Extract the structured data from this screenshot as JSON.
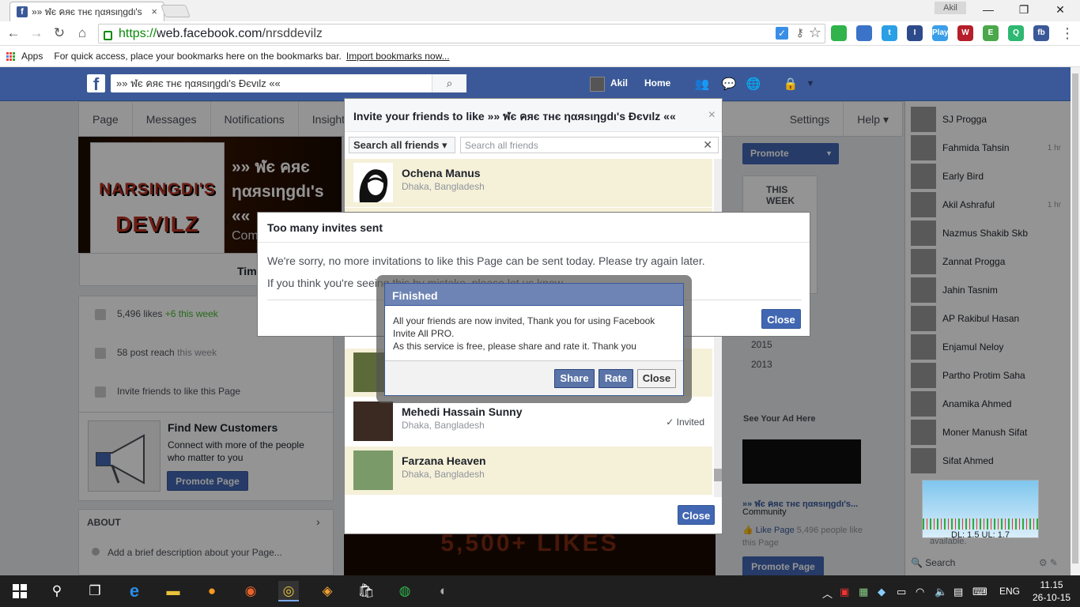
{
  "browser": {
    "tab_title": "»» ฬє คяє тнє ηαяsιηgdι's",
    "tab_close": "×",
    "user_badge": "Akil",
    "win_min": "—",
    "win_max": "❐",
    "win_close": "✕",
    "url_scheme": "https://",
    "url_host": "web.facebook.com",
    "url_path": "/nrsddevilz",
    "back": "←",
    "forward": "→",
    "reload": "↻",
    "home": "⌂",
    "star": "☆",
    "menu": "⋮",
    "extensions": [
      {
        "icon": "whatsapp-icon",
        "label": "",
        "color": "#2fb34a"
      },
      {
        "icon": "grid-ext-icon",
        "label": "",
        "color": "#3b73c8"
      },
      {
        "icon": "twitter-icon",
        "label": "t",
        "color": "#2b9fe6"
      },
      {
        "icon": "bookmark-ext-icon",
        "label": "I",
        "color": "#2d4a8a"
      },
      {
        "icon": "play-ext-icon",
        "label": "Play",
        "color": "#3a9ee8"
      },
      {
        "icon": "red-ext-icon",
        "label": "W",
        "color": "#b51e2a"
      },
      {
        "icon": "shield-ext-icon",
        "label": "E",
        "color": "#4aa84a"
      },
      {
        "icon": "g-ext-icon",
        "label": "Q",
        "color": "#2eb872"
      },
      {
        "icon": "fb-ext-icon",
        "label": "fb",
        "color": "#3b5998"
      }
    ]
  },
  "bookmarks": {
    "apps_label": "Apps",
    "hint": "For quick access, place your bookmarks here on the bookmarks bar.",
    "import_link": "Import bookmarks now..."
  },
  "facebook": {
    "logo": "f",
    "search_value": "»» ฬє คяє тнє ηαяsιηgdι's Đєvιlz ««",
    "search_icon": "⌕",
    "user_name": "Akil",
    "home": "Home",
    "page_nav": [
      "Page",
      "Messages",
      "Notifications",
      "Insights",
      "Settings",
      "Help ▾"
    ],
    "profile_pic_text": [
      "NARSINGDI'S",
      "DEVILZ"
    ],
    "page_name": "»» ฬє คяє ηαяsιηgdι's ««",
    "page_category": "Com",
    "timeline_tab": "Tim",
    "left": {
      "likes": "5,496 likes",
      "likes_week": "+6 this week",
      "reach": "58 post reach",
      "reach_week": "this week",
      "invite": "Invite friends to like this Page"
    },
    "find_customers": {
      "title": "Find New Customers",
      "desc": "Connect with more of the people who matter to you",
      "button": "Promote Page"
    },
    "about": {
      "title": "ABOUT",
      "desc": "Add a brief description about your Page..."
    },
    "right": {
      "promote": "Promote",
      "this_week": "THIS WEEK",
      "years": [
        "2015",
        "2013"
      ],
      "see_ad": "See Your Ad Here",
      "ad_name": "»» ฬє คяє тнє ηαяsιηgdι's...",
      "ad_category": "Community",
      "ad_like": "Like Page",
      "ad_like_count": "5,496 people like this Page",
      "promote_page": "Promote Page"
    },
    "chat": [
      {
        "name": "SJ Progga",
        "ago": ""
      },
      {
        "name": "Fahmida Tahsin",
        "ago": "1 hr"
      },
      {
        "name": "Early Bird",
        "ago": ""
      },
      {
        "name": "Akil Ashraful",
        "ago": "1 hr"
      },
      {
        "name": "Nazmus Shakib Skb",
        "ago": ""
      },
      {
        "name": "Zannat Progga",
        "ago": ""
      },
      {
        "name": "Jahin Tasnim",
        "ago": ""
      },
      {
        "name": "AP Rakibul Hasan",
        "ago": ""
      },
      {
        "name": "Enjamul Neloy",
        "ago": ""
      },
      {
        "name": "Partho Protim Saha",
        "ago": ""
      },
      {
        "name": "Anamika Ahmed",
        "ago": ""
      },
      {
        "name": "Moner Manush Sifat",
        "ago": ""
      },
      {
        "name": "Sifat Ahmed",
        "ago": ""
      }
    ],
    "chat_search": "Search",
    "available": "available."
  },
  "invite_dialog": {
    "title": "Invite your friends to like »» ฬє คяє тнє ηαяsιηgdι's Đєvιlz ««",
    "close_x": "×",
    "filter": "Search all friends ▾",
    "search_placeholder": "Search all friends",
    "friends": [
      {
        "name": "Ochena Manus",
        "location": "Dhaka, Bangladesh",
        "status": ""
      },
      {
        "name": "Mehedi Hassain Sunny",
        "location": "Dhaka, Bangladesh",
        "status": "✓ Invited"
      },
      {
        "name": "Farzana Heaven",
        "location": "Dhaka, Bangladesh",
        "status": ""
      }
    ],
    "close_button": "Close"
  },
  "banner_text": "5,500+ LIKES",
  "toomany_dialog": {
    "title": "Too many invites sent",
    "line1": "We're sorry, no more invitations to like this Page can be sent today. Please try again later.",
    "line2": "If you think you're seeing this by mistake, please let us know.",
    "close": "Close"
  },
  "finished_dialog": {
    "title": "Finished",
    "body1": "All your friends are now invited, Thank you for using Facebook Invite All PRO.",
    "body2": "As this service is free, please share and rate it. Thank you",
    "share": "Share",
    "rate": "Rate",
    "close": "Close"
  },
  "widget": {
    "speed": "DL: 1.5 UL: 1.7"
  },
  "taskbar": {
    "lang": "ENG",
    "time": "11.15",
    "date": "26-10-15"
  }
}
